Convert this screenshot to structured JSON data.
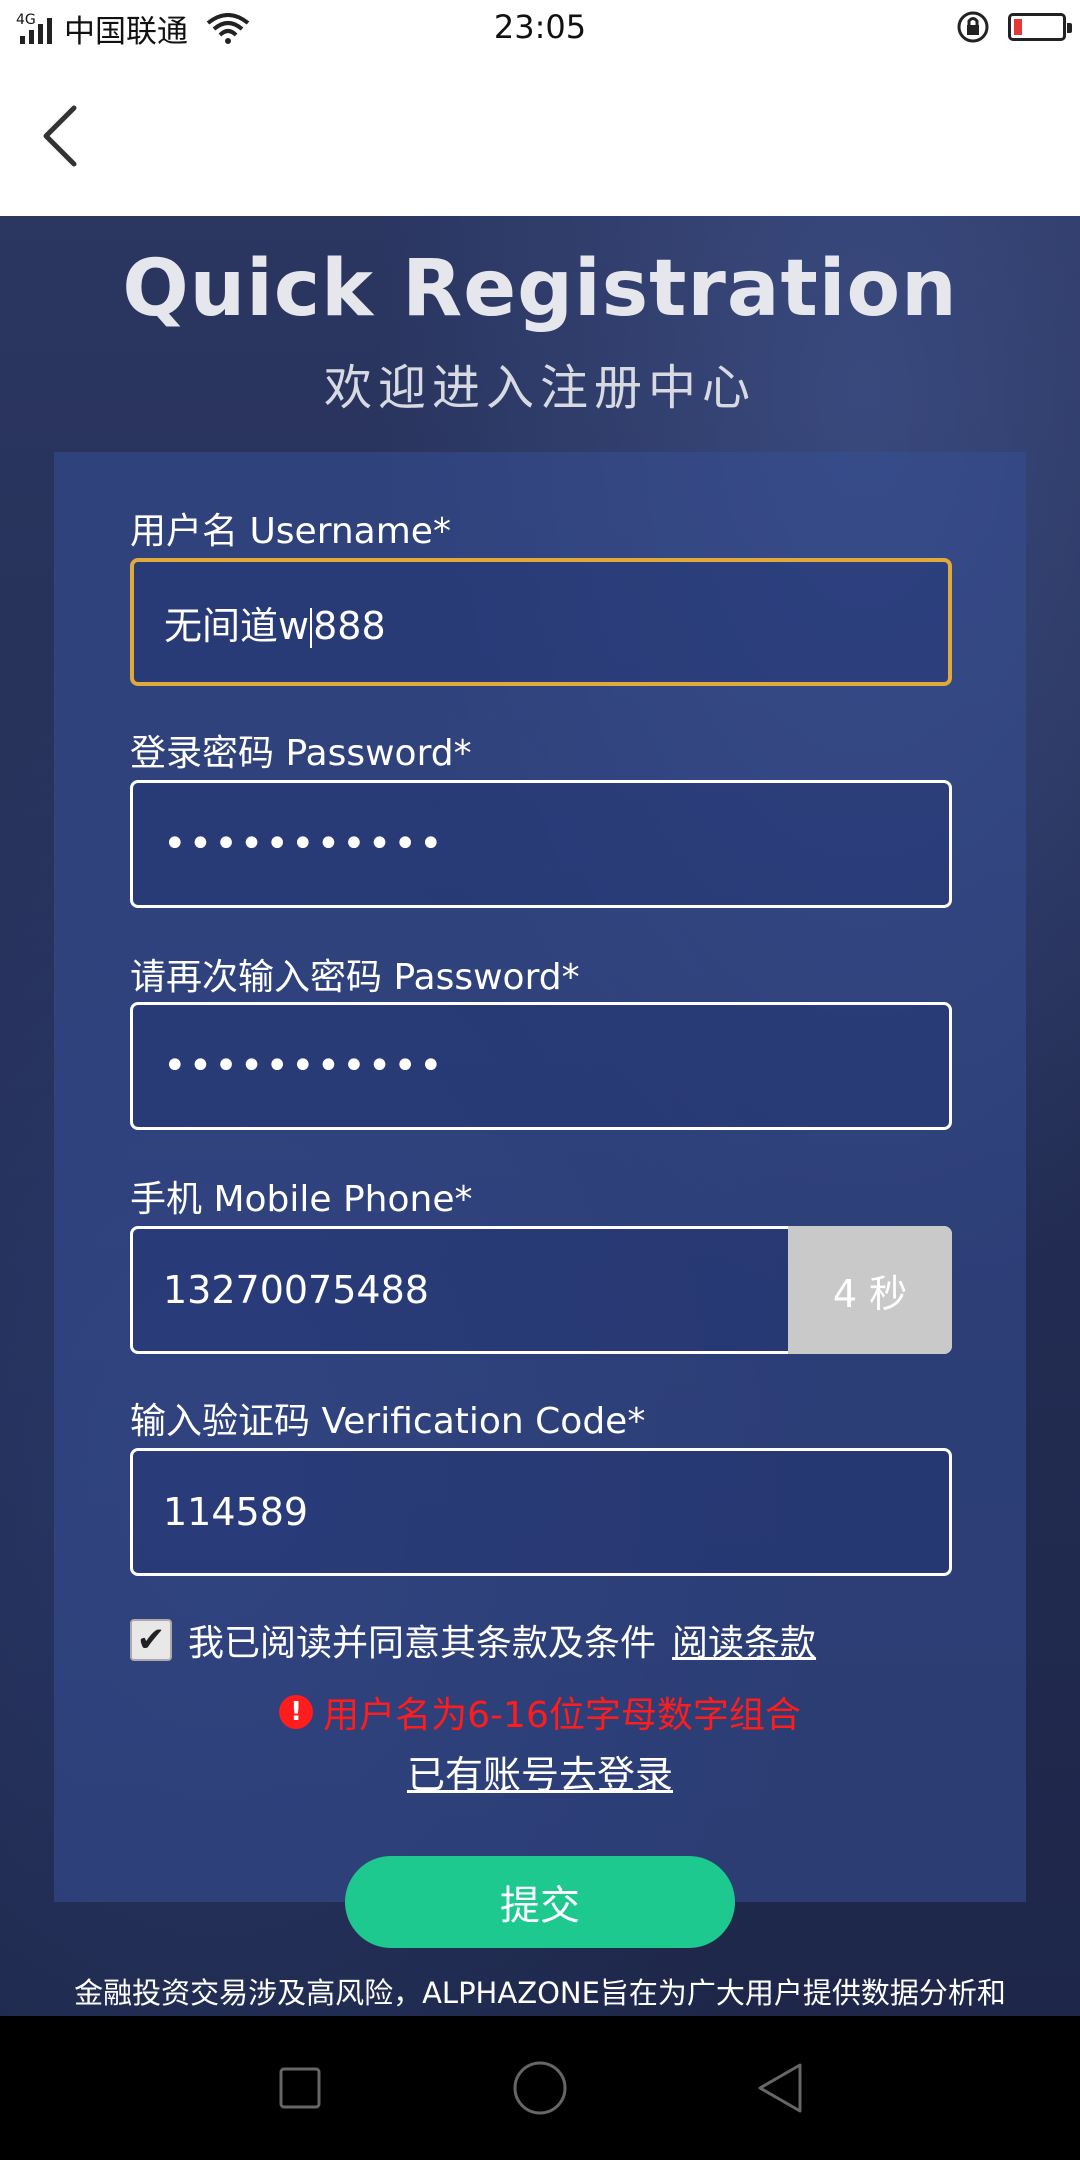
{
  "status_bar": {
    "network_type": "4G",
    "carrier": "中国联通",
    "time": "23:05",
    "battery_level": 0.15,
    "battery_color": "#e53935"
  },
  "header": {
    "back_icon": "chevron-left-icon"
  },
  "hero": {
    "title": "Quick Registration",
    "subtitle": "欢迎进入注册中心"
  },
  "form": {
    "username": {
      "label": "用户名 Username*",
      "value": "无间道w888",
      "focused": true
    },
    "password": {
      "label": "登录密码 Password*",
      "value": "•••••••••••"
    },
    "password_confirm": {
      "label": "请再次输入密码 Password*",
      "value": "•••••••••••"
    },
    "phone": {
      "label": "手机 Mobile Phone*",
      "value": "13270075488",
      "countdown_label": "4 秒"
    },
    "verification": {
      "label": "输入验证码 Verification Code*",
      "value": "114589"
    },
    "agreement": {
      "checked": true,
      "text": "我已阅读并同意其条款及条件",
      "link": "阅读条款"
    },
    "error": {
      "text": "用户名为6-16位字母数字组合",
      "color": "#ff1c1c"
    },
    "login_link": "已有账号去登录",
    "submit_label": "提交",
    "submit_color": "#1ec98f"
  },
  "disclaimer": {
    "line1": "金融投资交易涉及高风险，ALPHAZONE旨在为广大用户提供数据分析和"
  },
  "nav_bar": {
    "recent_icon": "square-icon",
    "home_icon": "circle-icon",
    "back_icon": "triangle-back-icon"
  }
}
